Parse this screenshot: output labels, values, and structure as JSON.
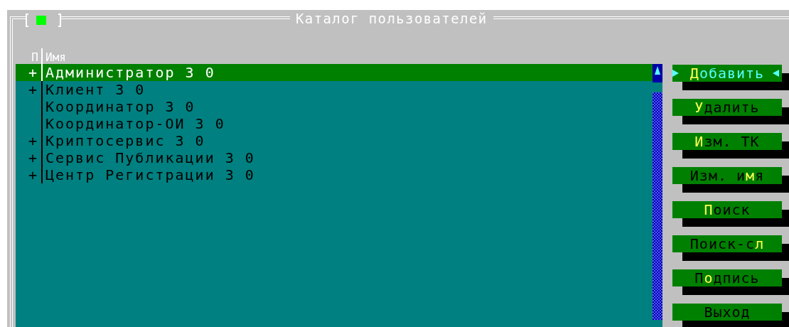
{
  "window": {
    "title": "Каталог пользователей"
  },
  "table": {
    "columns": [
      "П",
      "Имя"
    ],
    "rows": [
      {
        "mark": "+",
        "name": "Администратор 3 0",
        "selected": true
      },
      {
        "mark": "+",
        "name": "Клиент 3 0",
        "selected": false
      },
      {
        "name": "Координатор 3 0",
        "selected": false
      },
      {
        "name": "Координатор-ОИ 3 0",
        "selected": false
      },
      {
        "mark": "+",
        "name": "Криптосервис 3 0",
        "selected": false
      },
      {
        "mark": "+",
        "name": "Сервис Публикации 3 0",
        "selected": false
      },
      {
        "mark": "+",
        "name": "Центр Регистрации 3 0",
        "selected": false
      }
    ]
  },
  "buttons": [
    {
      "key": "Д",
      "post": "обавить",
      "selected": true
    },
    {
      "key": "У",
      "post": "далить",
      "selected": false
    },
    {
      "key": "И",
      "post": "зм. ТК",
      "selected": false
    },
    {
      "pre": "Изм. и",
      "key": "м",
      "post": "я",
      "selected": false
    },
    {
      "key": "П",
      "post": "оиск",
      "selected": false
    },
    {
      "pre": "Поиск-с",
      "key": "л",
      "selected": false
    },
    {
      "pre": "П",
      "key": "о",
      "post": "дпись",
      "selected": false
    },
    {
      "post": "Выход",
      "selected": false
    }
  ]
}
